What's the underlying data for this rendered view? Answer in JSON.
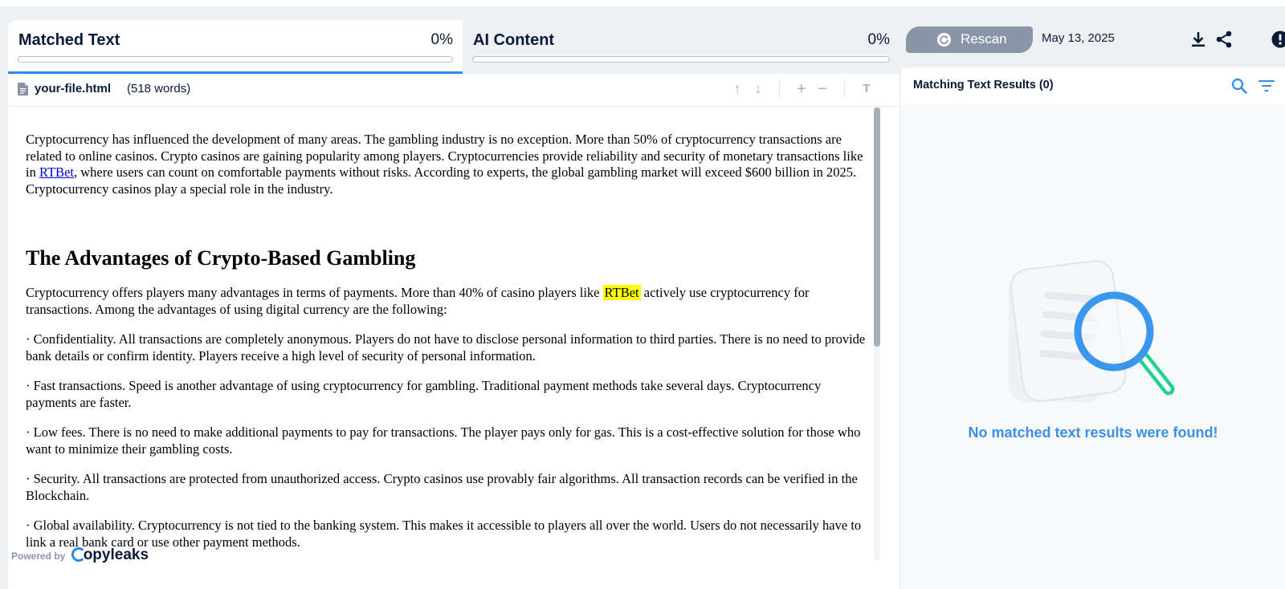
{
  "tabs": {
    "matched": {
      "label": "Matched Text",
      "percent": "0%",
      "progress": 0
    },
    "ai": {
      "label": "AI Content",
      "percent": "0%",
      "progress": 0
    }
  },
  "file": {
    "name": "your-file.html",
    "words": "(518 words)"
  },
  "toolbar_icons": [
    "arrow-up-icon",
    "arrow-down-icon",
    "zoom-in-icon",
    "zoom-out-icon",
    "text-format-icon"
  ],
  "document": {
    "intro_1": "Cryptocurrency has influenced the development of many areas. The gambling industry is no exception. More than 50% of cryptocurrency transactions are related to online casinos. Crypto casinos are gaining popularity among players. Cryptocurrencies provide reliability and security of monetary transactions like in ",
    "intro_link": "RTBet",
    "intro_2": ", where users can count on comfortable payments without risks. According to experts, the global gambling market will exceed $600 billion in 2025. Cryptocurrency casinos play a special role in the industry.",
    "heading": "The Advantages of Crypto-Based Gambling",
    "p2_1": "Cryptocurrency offers players many advantages in terms of payments. More than 40% of casino players like ",
    "p2_highlight": "RTBet",
    "p2_2": "actively use cryptocurrency for transactions. Among the advantages of using digital currency are the following:",
    "bullets": [
      "· Confidentiality. All transactions are completely anonymous. Players do not have to disclose personal information to third parties. There is no need to provide bank details or confirm identity. Players receive a high level of security of personal information.",
      "· Fast transactions. Speed is another advantage of using cryptocurrency for gambling. Traditional payment methods take several days. Cryptocurrency payments are faster.",
      "· Low fees. There is no need to make additional payments to pay for transactions. The player pays only for gas. This is a cost-effective solution for those who want to minimize their gambling costs.",
      "· Security. All transactions are protected from unauthorized access. Crypto casinos use provably fair algorithms. All transaction records can be verified in the Blockchain.",
      "· Global availability. Cryptocurrency is not tied to the banking system. This makes it accessible to players all over the world. Users do not necessarily have to link a real bank card or use other payment methods."
    ]
  },
  "footer": {
    "powered": "Powered by",
    "brand": "opyleaks"
  },
  "right": {
    "rescan": "Rescan",
    "date": "May 13, 2025",
    "icons": [
      "download-icon",
      "share-icon",
      "alert-icon"
    ],
    "results_title": "Matching Text Results (0)",
    "header_icons": [
      "search-icon",
      "filter-icon"
    ],
    "empty_message": "No matched text results were found!"
  },
  "colors": {
    "accent": "#2d8be8",
    "rescan_bg": "#8a96a8",
    "empty_message": "#3a90e6",
    "highlight": "#ffff00",
    "magnifier_green": "#22d38f"
  }
}
